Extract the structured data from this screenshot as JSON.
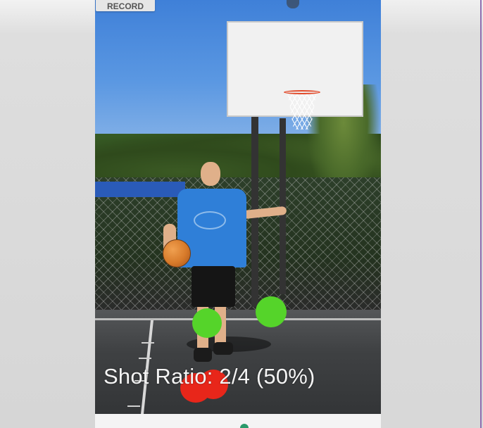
{
  "window": {
    "record_label": "RECORD"
  },
  "overlay": {
    "shot_ratio_text": "Shot Ratio: 2/4 (50%)"
  },
  "markers": [
    {
      "name": "made-shot-marker",
      "color": "#55d42a"
    },
    {
      "name": "made-shot-marker",
      "color": "#55d42a"
    },
    {
      "name": "missed-shot-marker",
      "color": "#e8261a"
    },
    {
      "name": "missed-shot-marker",
      "color": "#e8261a"
    }
  ],
  "colors": {
    "made": "#55d42a",
    "missed": "#e8261a"
  },
  "icons": {
    "bottom": "app-icon"
  }
}
